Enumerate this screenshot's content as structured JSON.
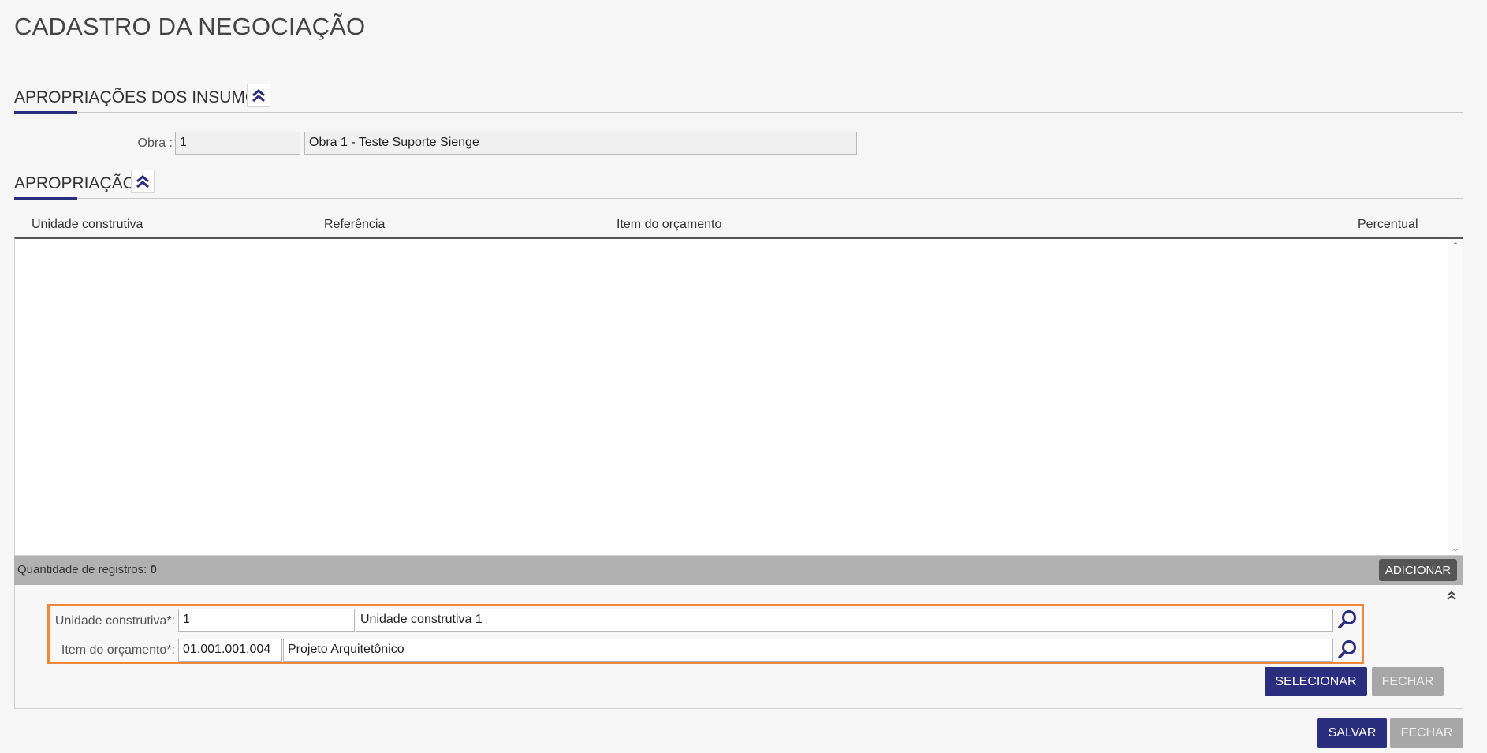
{
  "page_title": "CADASTRO DA NEGOCIAÇÃO",
  "section_insumos": {
    "title": "APROPRIAÇÕES DOS INSUMOS"
  },
  "obra": {
    "label": "Obra :",
    "code": "1",
    "name": "Obra 1 - Teste Suporte Sienge"
  },
  "section_apropriacao": {
    "title": "APROPRIAÇÃO"
  },
  "grid": {
    "columns": [
      "Unidade construtiva",
      "Referência",
      "Item do orçamento",
      "Percentual"
    ],
    "rows": [],
    "count_label": "Quantidade de registros:",
    "count_value": "0",
    "add_button": "ADICIONAR"
  },
  "form": {
    "unidade": {
      "label": "Unidade construtiva*:",
      "code": "1",
      "name": "Unidade construtiva 1"
    },
    "item": {
      "label": "Item do orçamento*:",
      "code": "01.001.001.004",
      "name": "Projeto Arquitetônico"
    },
    "select_button": "SELECIONAR",
    "close_button": "FECHAR"
  },
  "footer": {
    "save_button": "SALVAR",
    "close_button": "FECHAR"
  },
  "colors": {
    "primary": "#2b2d7e",
    "highlight": "#f0883a",
    "disabled": "#a7a7a7"
  }
}
